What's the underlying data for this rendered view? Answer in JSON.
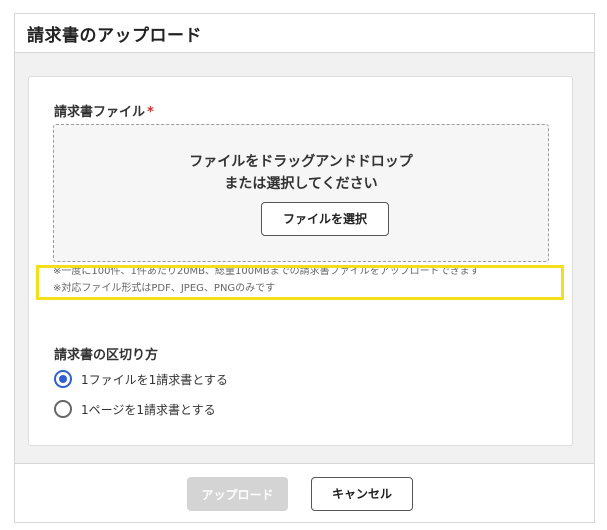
{
  "dialog": {
    "title": "請求書のアップロード"
  },
  "file_field": {
    "label": "請求書ファイル",
    "required_mark": "*",
    "dropzone_line1": "ファイルをドラッグアンドドロップ",
    "dropzone_line2": "または選択してください",
    "select_button": "ファイルを選択"
  },
  "notes": {
    "limit": "※一度に100件、1件あたり20MB、総量100MBまでの請求書ファイルをアップロードできます",
    "formats": "※対応ファイル形式はPDF、JPEG、PNGのみです"
  },
  "split_mode": {
    "label": "請求書の区切り方",
    "options": [
      {
        "label": "1ファイルを1請求書とする",
        "selected": true
      },
      {
        "label": "1ページを1請求書とする",
        "selected": false
      }
    ]
  },
  "footer": {
    "upload_button": "アップロード",
    "cancel_button": "キャンセル"
  },
  "colors": {
    "accent": "#2f5fd0",
    "required": "#d0312d",
    "highlight": "#f3e01b",
    "disabled_button": "#d4d4d4"
  }
}
